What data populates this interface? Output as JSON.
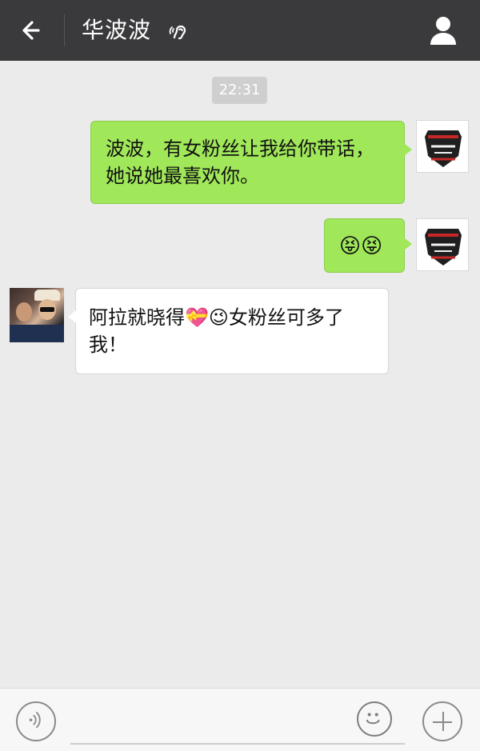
{
  "header": {
    "title": "华波波"
  },
  "chat": {
    "time": "22:31",
    "messages": [
      {
        "sender": "self",
        "text": "波波，有女粉丝让我给你带话，她说她最喜欢你。"
      },
      {
        "sender": "self",
        "emoji": "😝😝"
      },
      {
        "sender": "other",
        "text": "阿拉就晓得💝😉女粉丝可多了我！"
      }
    ]
  },
  "icons": {
    "back": "back-arrow-icon",
    "ear": "ear-icon",
    "profile": "profile-icon",
    "voice": "voice-icon",
    "emoji": "smiley-icon",
    "plus": "plus-icon"
  }
}
